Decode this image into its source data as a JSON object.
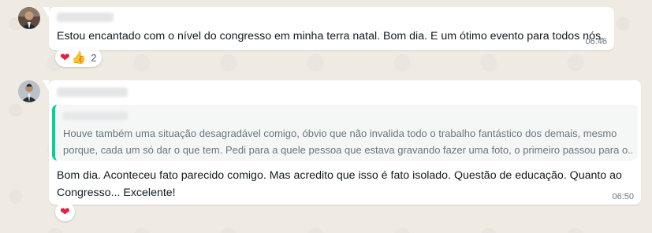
{
  "messages": [
    {
      "sender_blurred": "",
      "text": "Estou encantado com o nível do congresso em minha terra natal. Bom dia. E um ótimo evento para todos nós.",
      "time": "06:46",
      "reactions": {
        "emojis": [
          "heart",
          "thumbs-up"
        ],
        "count": "2"
      }
    },
    {
      "sender_blurred": "",
      "quote": {
        "sender_blurred": "",
        "line1": "Houve também uma situação desagradável comigo, óbvio que não invalida todo o trabalho fantástico dos demais, mesmo",
        "line2": "porque, cada um só dar o que tem. Pedi para a quele pessoa que estava gravando fazer uma foto, o primeiro passou para o..."
      },
      "text_line1": "Bom dia. Aconteceu fato parecido comigo. Mas acredito que isso é fato isolado. Questão de educação. Quanto ao",
      "text_line2": "Congresso... Excelente!",
      "time": "06:50",
      "reactions": {
        "emojis": [
          "heart"
        ]
      }
    }
  ],
  "colors": {
    "background": "#efeae2",
    "bubble": "#ffffff",
    "quote_bar": "#06cf9c",
    "heart": "#e41e3f"
  }
}
